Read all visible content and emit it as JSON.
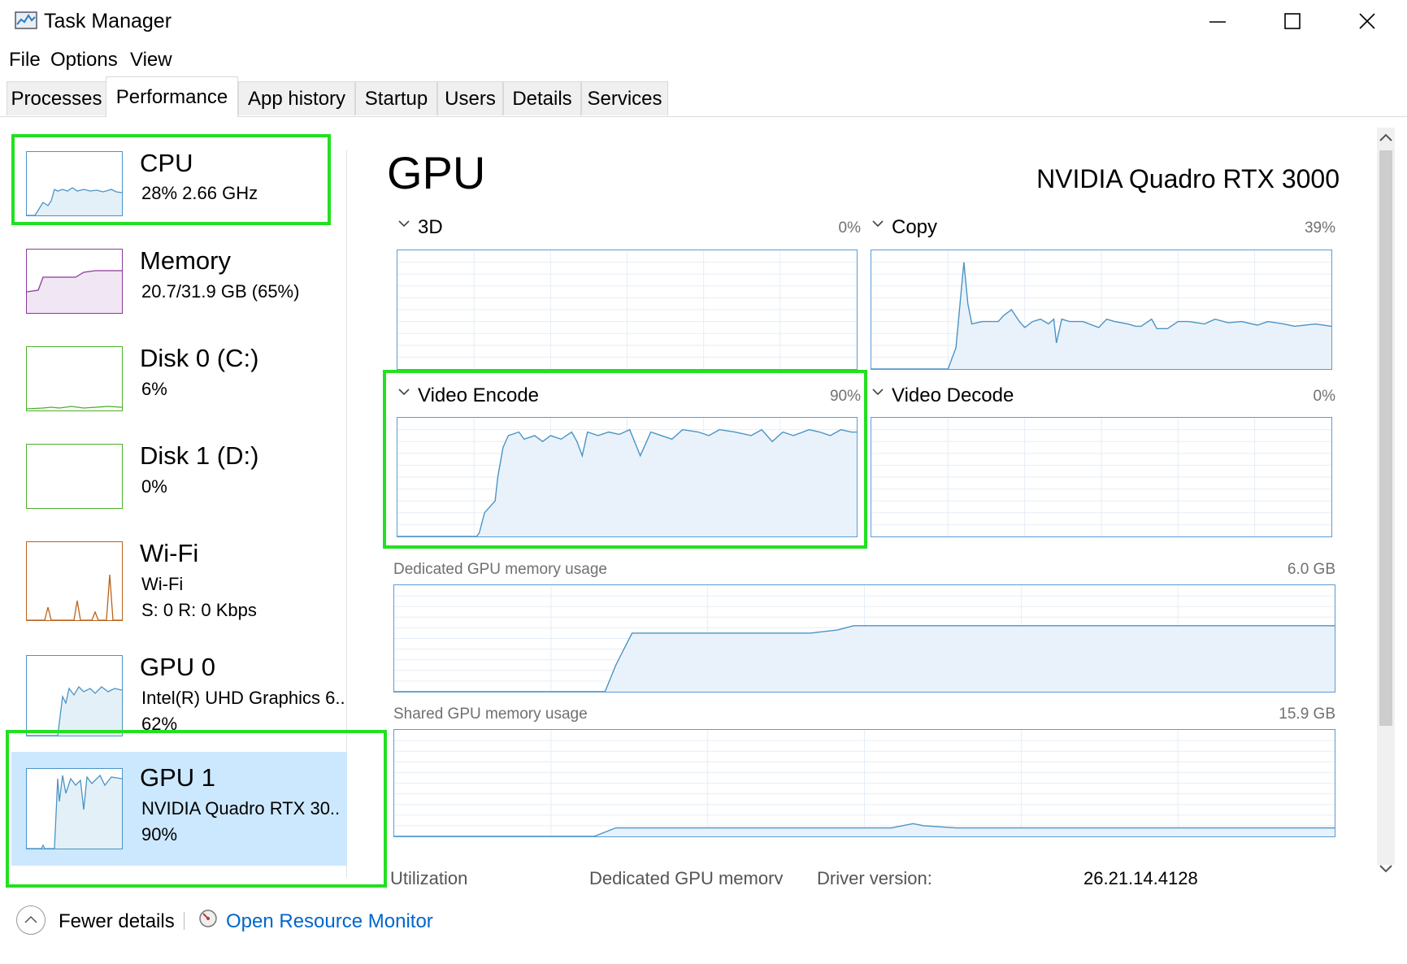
{
  "window": {
    "title": "Task Manager"
  },
  "menu": [
    "File",
    "Options",
    "View"
  ],
  "tabs": [
    "Processes",
    "Performance",
    "App history",
    "Startup",
    "Users",
    "Details",
    "Services"
  ],
  "active_tab": "Performance",
  "sidebar": {
    "items": [
      {
        "title": "CPU",
        "line1": "28%  2.66 GHz",
        "line2": "",
        "color": "#4a94c6"
      },
      {
        "title": "Memory",
        "line1": "20.7/31.9 GB (65%)",
        "line2": "",
        "color": "#8b3a9b"
      },
      {
        "title": "Disk 0 (C:)",
        "line1": "6%",
        "line2": "",
        "color": "#4caf2a"
      },
      {
        "title": "Disk 1 (D:)",
        "line1": "0%",
        "line2": "",
        "color": "#4caf2a"
      },
      {
        "title": "Wi-Fi",
        "line1": "Wi-Fi",
        "line2": "S: 0  R: 0 Kbps",
        "color": "#b9631a"
      },
      {
        "title": "GPU 0",
        "line1": "Intel(R) UHD Graphics 6..",
        "line2": "62%",
        "color": "#4a94c6"
      },
      {
        "title": "GPU 1",
        "line1": "NVIDIA Quadro RTX 30..",
        "line2": "90%",
        "color": "#4a94c6"
      }
    ]
  },
  "main": {
    "title": "GPU",
    "device_name": "NVIDIA Quadro RTX 3000",
    "engines": [
      {
        "name": "3D",
        "value": "0%"
      },
      {
        "name": "Copy",
        "value": "39%"
      },
      {
        "name": "Video Encode",
        "value": "90%"
      },
      {
        "name": "Video Decode",
        "value": "0%"
      }
    ],
    "dedicated": {
      "label": "Dedicated GPU memory usage",
      "max": "6.0 GB"
    },
    "shared": {
      "label": "Shared GPU memory usage",
      "max": "15.9 GB"
    },
    "stats": {
      "utilization": "Utilization",
      "dedicated_mem": "Dedicated GPU memory",
      "driver_version_label": "Driver version:",
      "driver_version": "26.21.14.4128"
    }
  },
  "footer": {
    "fewer_details": "Fewer details",
    "open_monitor": "Open Resource Monitor"
  },
  "colors": {
    "accent": "#4a94c6",
    "highlight": "#22e022",
    "selected": "#cce8ff",
    "link": "#0066cc"
  }
}
